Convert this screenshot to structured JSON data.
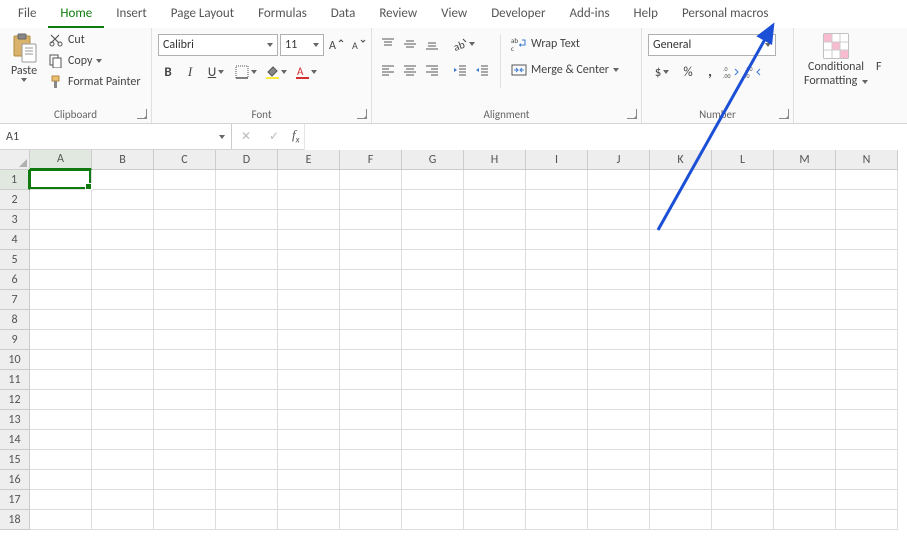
{
  "tabs": [
    "File",
    "Home",
    "Insert",
    "Page Layout",
    "Formulas",
    "Data",
    "Review",
    "View",
    "Developer",
    "Add-ins",
    "Help",
    "Personal macros"
  ],
  "activeTab": "Home",
  "clipboard": {
    "paste": "Paste",
    "cut": "Cut",
    "copy": "Copy",
    "painter": "Format Painter",
    "group": "Clipboard"
  },
  "font": {
    "name": "Calibri",
    "size": "11",
    "group": "Font",
    "bold": "B",
    "italic": "I",
    "underline": "U"
  },
  "alignment": {
    "wrap": "Wrap Text",
    "merge": "Merge & Center",
    "group": "Alignment"
  },
  "number": {
    "format": "General",
    "group": "Number",
    "currency": "$",
    "percent": "%",
    "comma": ",",
    "incdec_inc": ".00→.0",
    "incdec_dec": ".0→.00"
  },
  "styles": {
    "conditional": "Conditional",
    "formatting": "Formatting",
    "extra": "F"
  },
  "namebox": "A1",
  "formula": "",
  "columns": [
    "A",
    "B",
    "C",
    "D",
    "E",
    "F",
    "G",
    "H",
    "I",
    "J",
    "K",
    "L",
    "M",
    "N"
  ],
  "rows": [
    "1",
    "2",
    "3",
    "4",
    "5",
    "6",
    "7",
    "8",
    "9",
    "10",
    "11",
    "12",
    "13",
    "14",
    "15",
    "16",
    "17",
    "18"
  ],
  "selectedCell": {
    "col": 0,
    "row": 0
  }
}
